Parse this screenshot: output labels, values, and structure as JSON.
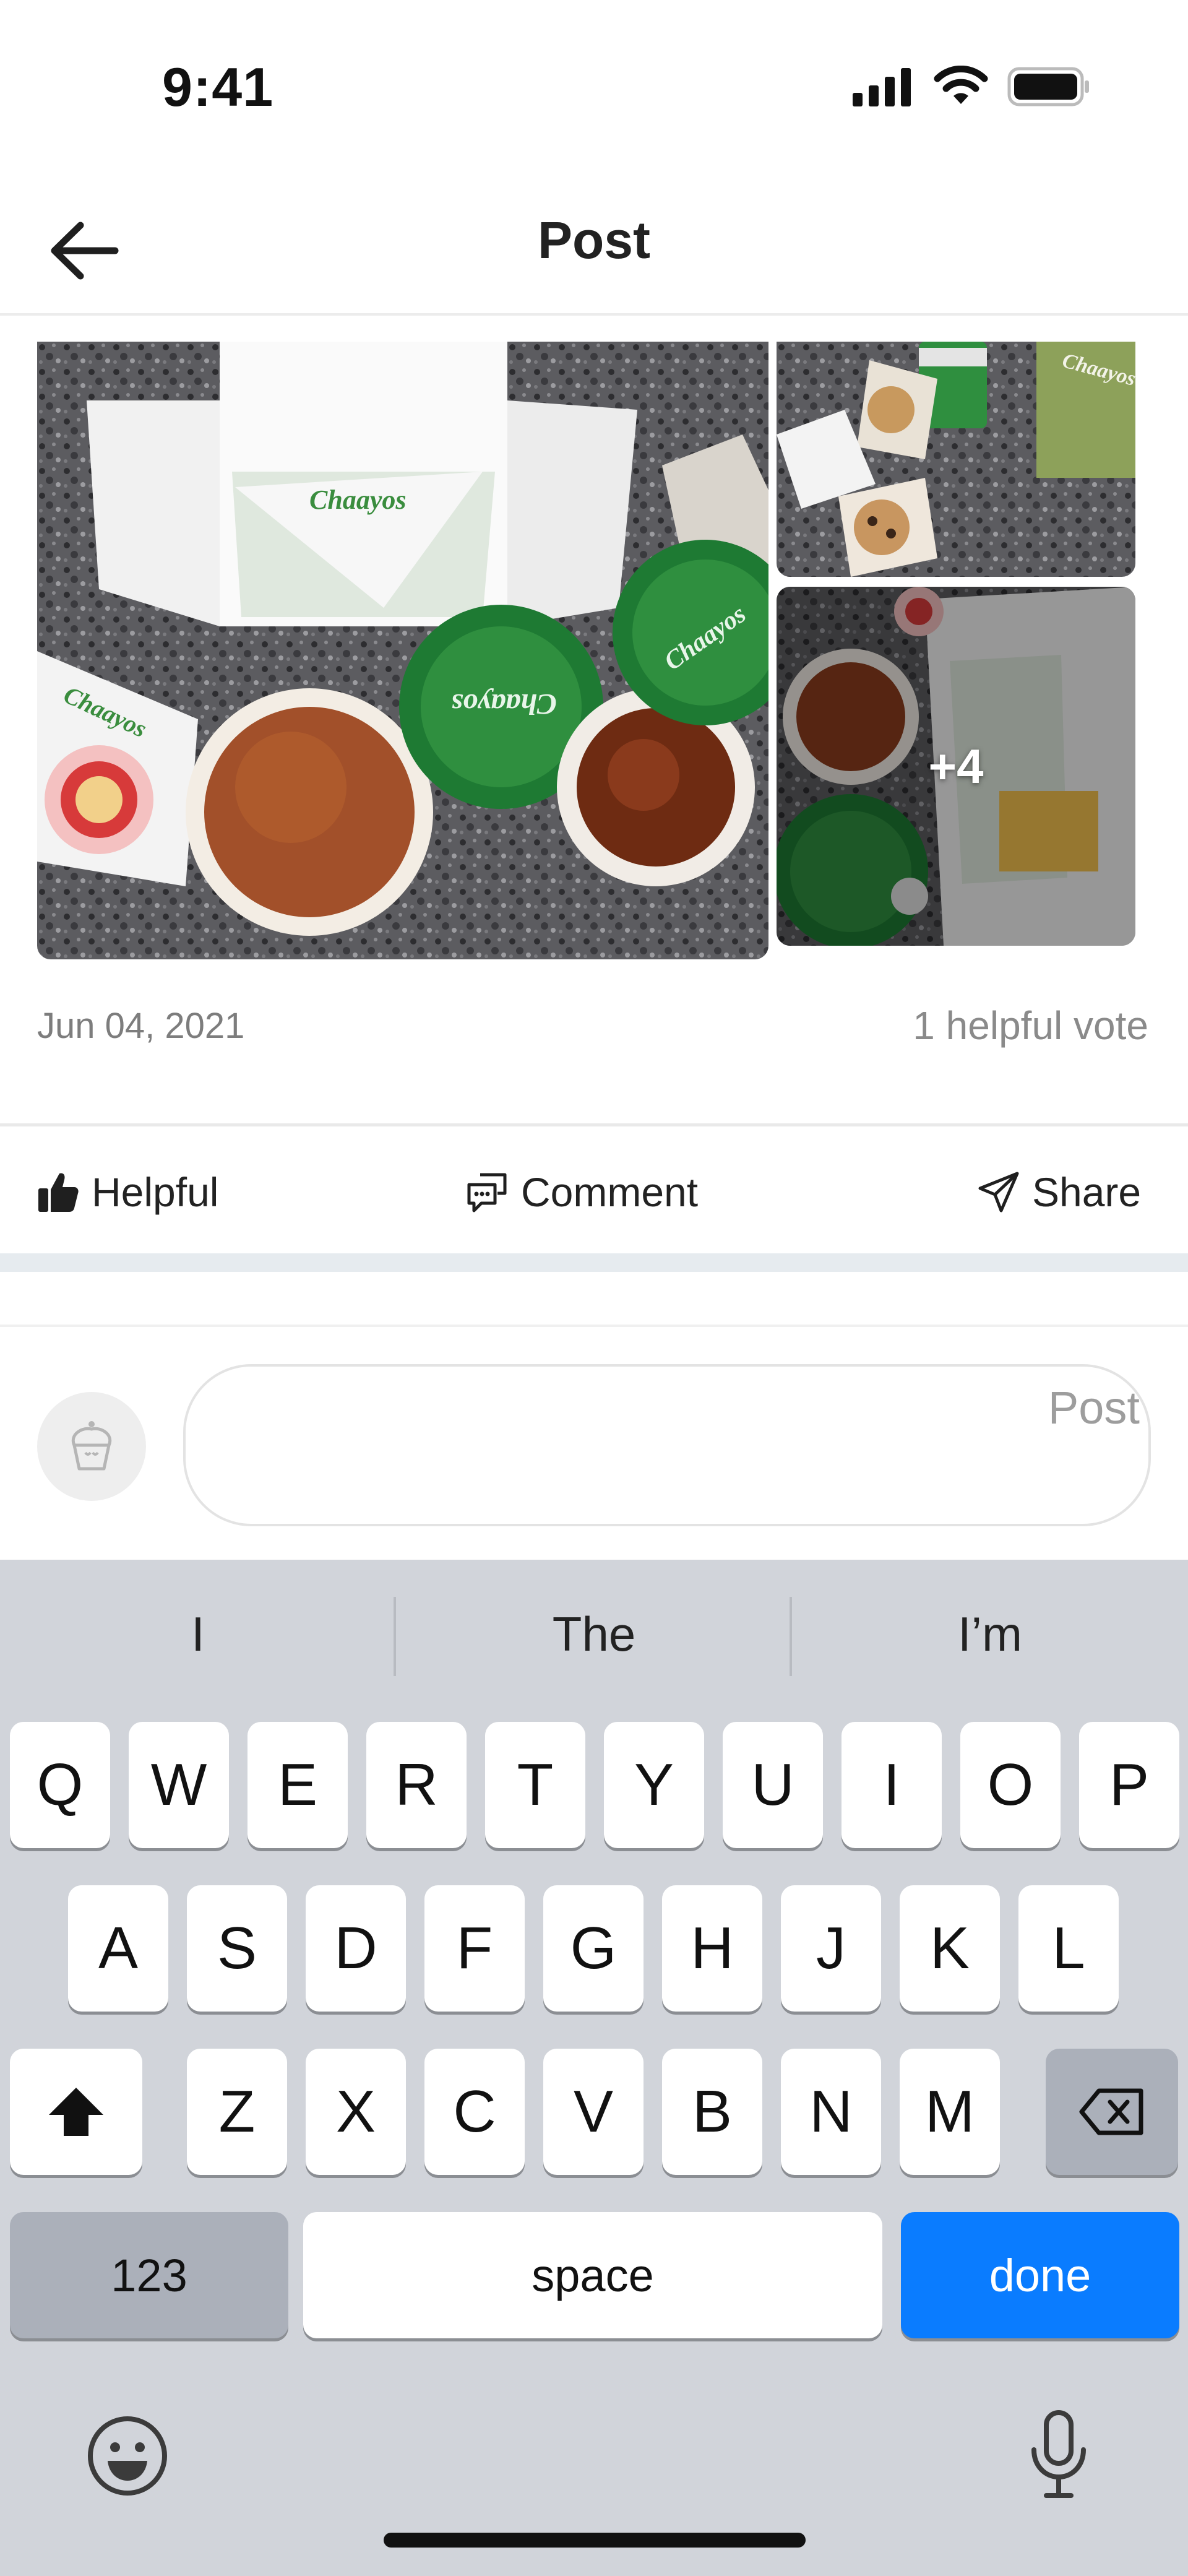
{
  "status_bar": {
    "time": "9:41"
  },
  "header": {
    "title": "Post"
  },
  "post": {
    "photos": {
      "brand_text": "Chaayos",
      "more_count_label": "+4"
    },
    "date": "Jun 04, 2021",
    "helpful_votes": "1 helpful vote"
  },
  "actions": {
    "helpful": "Helpful",
    "comment": "Comment",
    "share": "Share"
  },
  "composer": {
    "post_label": "Post",
    "input_value": "",
    "input_placeholder": ""
  },
  "keyboard": {
    "suggestions": [
      "I",
      "The",
      "I’m"
    ],
    "row1": [
      "Q",
      "W",
      "E",
      "R",
      "T",
      "Y",
      "U",
      "I",
      "O",
      "P"
    ],
    "row2": [
      "A",
      "S",
      "D",
      "F",
      "G",
      "H",
      "J",
      "K",
      "L"
    ],
    "row3": [
      "Z",
      "X",
      "C",
      "V",
      "B",
      "N",
      "M"
    ],
    "numbers_label": "123",
    "space_label": "space",
    "done_label": "done"
  },
  "colors": {
    "accent_blue": "#0a7cff",
    "brand_green": "#2e7d32",
    "keyboard_bg": "#d1d4da"
  },
  "icons": [
    "back-arrow-icon",
    "signal-icon",
    "wifi-icon",
    "battery-icon",
    "thumbs-up-icon",
    "comment-icon",
    "share-icon",
    "cupcake-icon",
    "shift-icon",
    "backspace-icon",
    "emoji-icon",
    "microphone-icon"
  ]
}
